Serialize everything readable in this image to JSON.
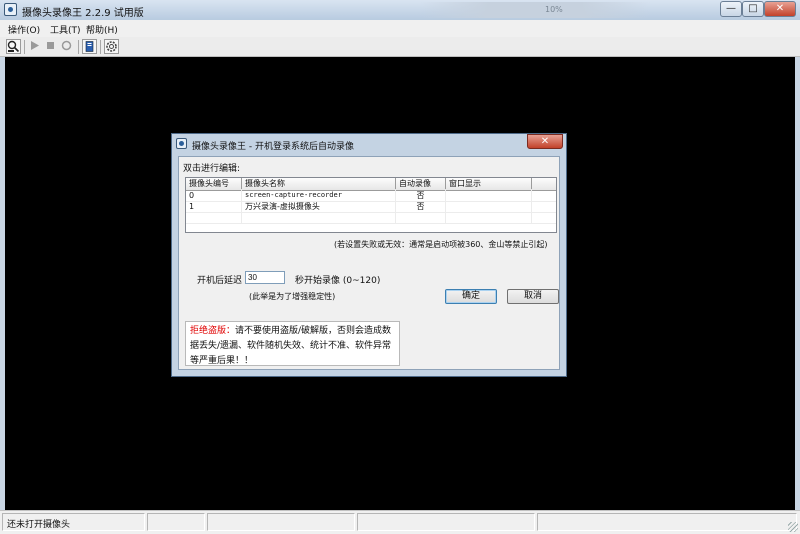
{
  "window": {
    "title": "摄像头录像王 2.2.9 试用版",
    "background_hint": [
      "10%"
    ],
    "controls": {
      "minimize": "—",
      "maximize": "□",
      "close": "✕"
    }
  },
  "menu": [
    {
      "label": "操作(O)"
    },
    {
      "label": "工具(T)"
    },
    {
      "label": "帮助(H)"
    }
  ],
  "toolbar": {
    "icons": [
      "search-camera-icon",
      "play-icon",
      "stop-icon",
      "record-icon",
      "book-icon",
      "settings-gear-icon"
    ]
  },
  "dialog": {
    "title": "摄像头录像王 - 开机登录系统后自动录像",
    "close_label": "✕",
    "hint": "双击进行编辑:",
    "columns": [
      "摄像头编号",
      "摄像头名称",
      "自动录像",
      "窗口显示"
    ],
    "rows": [
      {
        "id": "0",
        "name": "screen-capture-recorder",
        "auto": "否",
        "window": ""
      },
      {
        "id": "1",
        "name": "万兴录演-虚拟摄像头",
        "auto": "否",
        "window": ""
      }
    ],
    "note": "(若设置失败或无效：通常是启动项被360、金山等禁止引起)",
    "delay_label": "开机后延迟",
    "delay_value": "30",
    "delay_suffix": "秒开始录像 (0~120)",
    "delay_note": "(此举是为了增强稳定性)",
    "ok_label": "确定",
    "cancel_label": "取消",
    "warning_title": "拒绝盗版：",
    "warning_text": "请不要使用盗版/破解版，否则会造成数据丢失/遗漏、软件随机失效、统计不准、软件异常等严重后果！！"
  },
  "statusbar": {
    "text": "还未打开摄像头"
  },
  "colors": {
    "title_bar": "#c9d6e4",
    "client_bg": "#000000",
    "warning_red": "#e00000",
    "close_button": "#c2412a"
  }
}
